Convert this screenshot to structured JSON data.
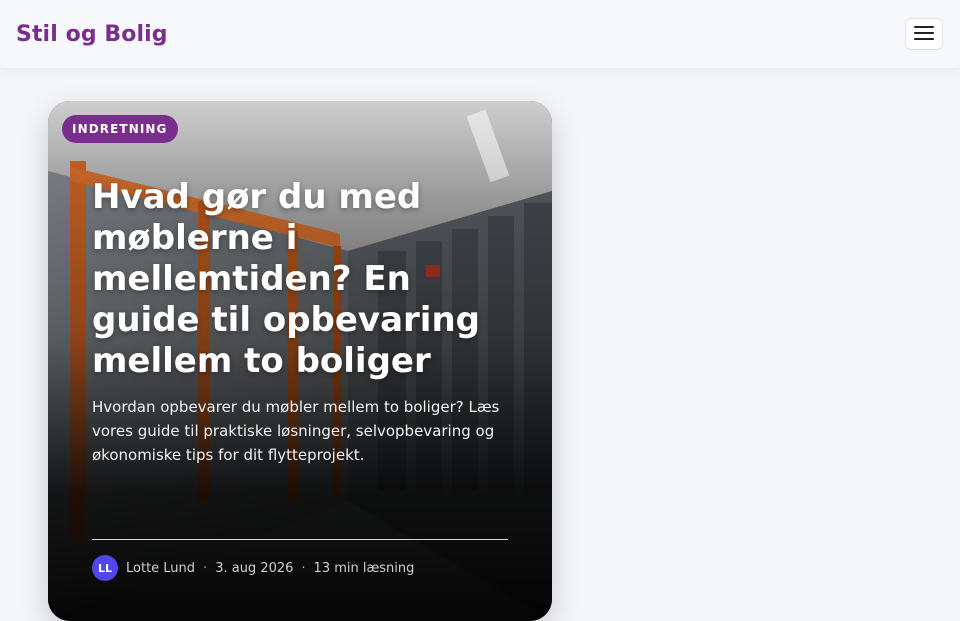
{
  "site": {
    "brand": "Stil og Bolig",
    "menu_icon": "hamburger-menu-icon"
  },
  "article": {
    "category": "INDRETNING",
    "title": "Hvad gør du med møblerne i mellemtiden? En guide til opbevaring mellem to boliger",
    "excerpt": "Hvordan opbevarer du møbler mellem to boliger? Læs vores guide til praktiske løsninger, selvopbevaring og økonomiske tips for dit flytteprojekt.",
    "author_initials": "LL",
    "author": "Lotte Lund",
    "date": "3. aug 2026",
    "read_time": "13 min læsning",
    "meta_separator": "·",
    "image_alt": "Korridor i et selvopbevaringsanlæg med rullemoduler"
  },
  "colors": {
    "brand": "#7b2d8e",
    "badge": "#7a2e8c",
    "avatar": "#5147e6",
    "page_bg": "#f4f6f9"
  }
}
